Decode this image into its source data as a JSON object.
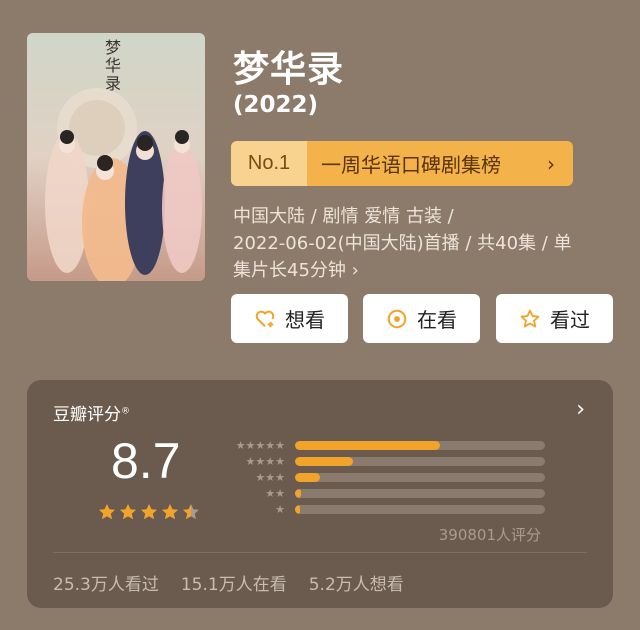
{
  "title": "梦华录",
  "year": "(2022)",
  "poster": {
    "title_text": "梦华录"
  },
  "rank": {
    "badge": "No.1",
    "text": "一周华语口碑剧集榜",
    "arrow": "›"
  },
  "meta": {
    "line1": "中国大陆 / 剧情 爱情 古装 /",
    "line2": "2022-06-02(中国大陆)首播 / 共40集 / 单",
    "line3": "集片长45分钟 ›"
  },
  "buttons": {
    "want": "想看",
    "watching": "在看",
    "watched": "看过"
  },
  "rating": {
    "heading": "豆瓣评分",
    "registered": "®",
    "arrow": "›",
    "score": "8.7",
    "stars": 4.5,
    "distribution": [
      0.58,
      0.23,
      0.1,
      0.025,
      0.02
    ],
    "total": "390801人评分"
  },
  "stats": {
    "watched": "25.3万人看过",
    "watching": "15.1万人在看",
    "want": "5.2万人想看"
  },
  "colors": {
    "background": "#8c7b6b",
    "card": "#6b5b4e",
    "accent": "#f1a32a",
    "rank_bg": "#f3b34a"
  }
}
